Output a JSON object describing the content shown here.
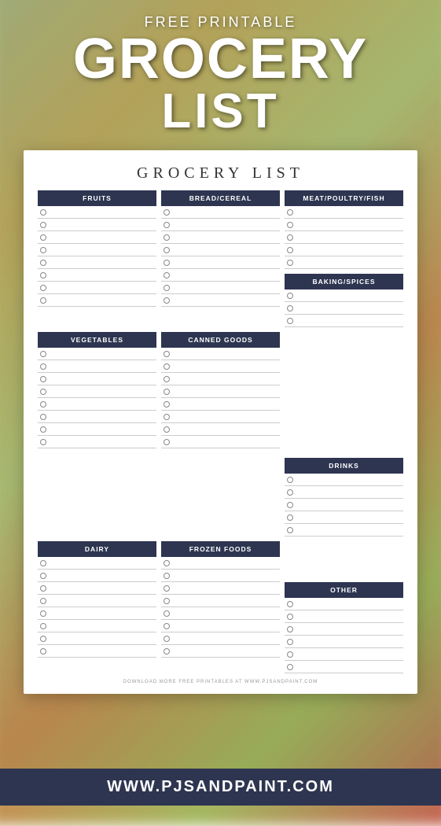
{
  "header": {
    "free_printable": "FREE PRINTABLE",
    "grocery": "GROCERY",
    "list": "LIST"
  },
  "card": {
    "title": "GROCERY LIST",
    "sections": {
      "fruits": "FRUITS",
      "bread_cereal": "BREAD/CEREAL",
      "meat": "MEAT/POULTRY/FISH",
      "vegetables": "VEGETABLES",
      "canned_goods": "CANNED GOODS",
      "baking_spices": "BAKING/SPICES",
      "dairy": "DAIRY",
      "frozen_foods": "FROZEN FOODS",
      "drinks": "DRINKS",
      "other": "OTHER"
    },
    "footer": "DOWNLOAD MORE FREE PRINTABLES AT WWW.PJSANDPAINT.COM"
  },
  "bottom_bar": {
    "url": "WWW.PJSANDPAINT.COM"
  }
}
